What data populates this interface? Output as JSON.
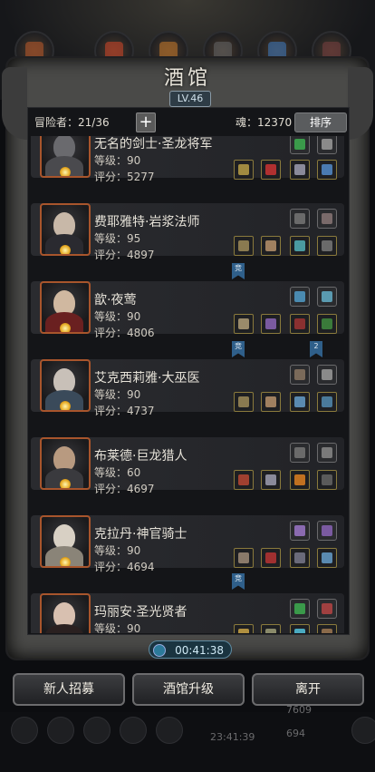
{
  "title": "酒馆",
  "level": "LV.46",
  "header": {
    "adventurers": "冒险者：21/36",
    "add_label": "+",
    "soul": "魂：12370",
    "sort_label": "排序"
  },
  "heroes": [
    {
      "name": "无名的剑士·圣龙将军",
      "level": "等级：90",
      "score": "评分：5277"
    },
    {
      "name": "费耶雅特·岩浆法师",
      "level": "等级：95",
      "score": "评分：4897"
    },
    {
      "name": "歆·夜莺",
      "level": "等级：90",
      "score": "评分：4806"
    },
    {
      "name": "艾克西莉雅·大巫医",
      "level": "等级：90",
      "score": "评分：4737"
    },
    {
      "name": "布莱德·巨龙猎人",
      "level": "等级：60",
      "score": "评分：4697"
    },
    {
      "name": "克拉丹·神官骑士",
      "level": "等级：90",
      "score": "评分：4694"
    },
    {
      "name": "玛丽安·圣光贤者",
      "level": "等级：90",
      "score": "评分：?"
    }
  ],
  "ribbons": {
    "r1": "竞",
    "r2": "竞",
    "r3": "2",
    "r4": "竞"
  },
  "timer": "00:41:38",
  "buttons": {
    "recruit": "新人招募",
    "upgrade": "酒馆升级",
    "leave": "离开"
  },
  "bottom": {
    "time": "23:41:39",
    "gold": "7609",
    "gems": "694"
  }
}
